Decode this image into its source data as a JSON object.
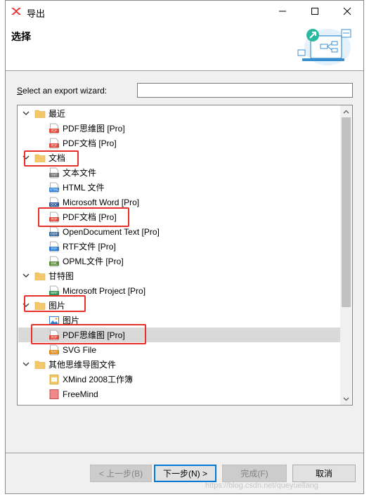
{
  "window": {
    "title": "导出",
    "controls": {
      "minimize": "—",
      "maximize": "☐",
      "close": "✕"
    }
  },
  "banner": {
    "title": "选择"
  },
  "filter": {
    "label_underlined": "S",
    "label_rest": "elect an export wizard:",
    "value": "",
    "placeholder": ""
  },
  "tree": {
    "rows": [
      {
        "label": "最近",
        "icon": "folder-icon",
        "level": 0,
        "expanded": true
      },
      {
        "label": "PDF思维图 [Pro]",
        "icon": "pdf-icon",
        "level": 1
      },
      {
        "label": "PDF文档 [Pro]",
        "icon": "pdf-icon",
        "level": 1
      },
      {
        "label": "文档",
        "icon": "folder-icon",
        "level": 0,
        "expanded": true
      },
      {
        "label": "文本文件",
        "icon": "txt-icon",
        "level": 1
      },
      {
        "label": "HTML 文件",
        "icon": "html-icon",
        "level": 1
      },
      {
        "label": "Microsoft Word [Pro]",
        "icon": "doc-icon",
        "level": 1
      },
      {
        "label": "PDF文档 [Pro]",
        "icon": "pdf-icon",
        "level": 1
      },
      {
        "label": "OpenDocument Text [Pro]",
        "icon": "odt-icon",
        "level": 1
      },
      {
        "label": "RTF文件 [Pro]",
        "icon": "rtf-icon",
        "level": 1
      },
      {
        "label": "OPML文件 [Pro]",
        "icon": "opml-icon",
        "level": 1
      },
      {
        "label": "甘特图",
        "icon": "folder-icon",
        "level": 0,
        "expanded": true
      },
      {
        "label": "Microsoft Project [Pro]",
        "icon": "mpp-icon",
        "level": 1
      },
      {
        "label": "图片",
        "icon": "folder-icon",
        "level": 0,
        "expanded": true
      },
      {
        "label": "图片",
        "icon": "image-icon",
        "level": 1
      },
      {
        "label": "PDF思维图 [Pro]",
        "icon": "pdf-icon",
        "level": 1,
        "selected": true
      },
      {
        "label": "SVG File",
        "icon": "svg-icon",
        "level": 1
      },
      {
        "label": "其他思维导图文件",
        "icon": "folder-icon",
        "level": 0,
        "expanded": true
      },
      {
        "label": "XMind 2008工作簿",
        "icon": "xmind-icon",
        "level": 1
      },
      {
        "label": "FreeMind",
        "icon": "freemind-icon",
        "level": 1
      }
    ]
  },
  "buttons": {
    "back": "< 上一步(B)",
    "next": "下一步(N) >",
    "finish": "完成(F)",
    "cancel": "取消"
  },
  "watermark": "https://blog.csdn.net/queyuellang",
  "colors": {
    "highlight": "#e8302a",
    "selection": "#d9d9d9",
    "folder": "#f4c86a",
    "pdf": "#e04a3a"
  }
}
